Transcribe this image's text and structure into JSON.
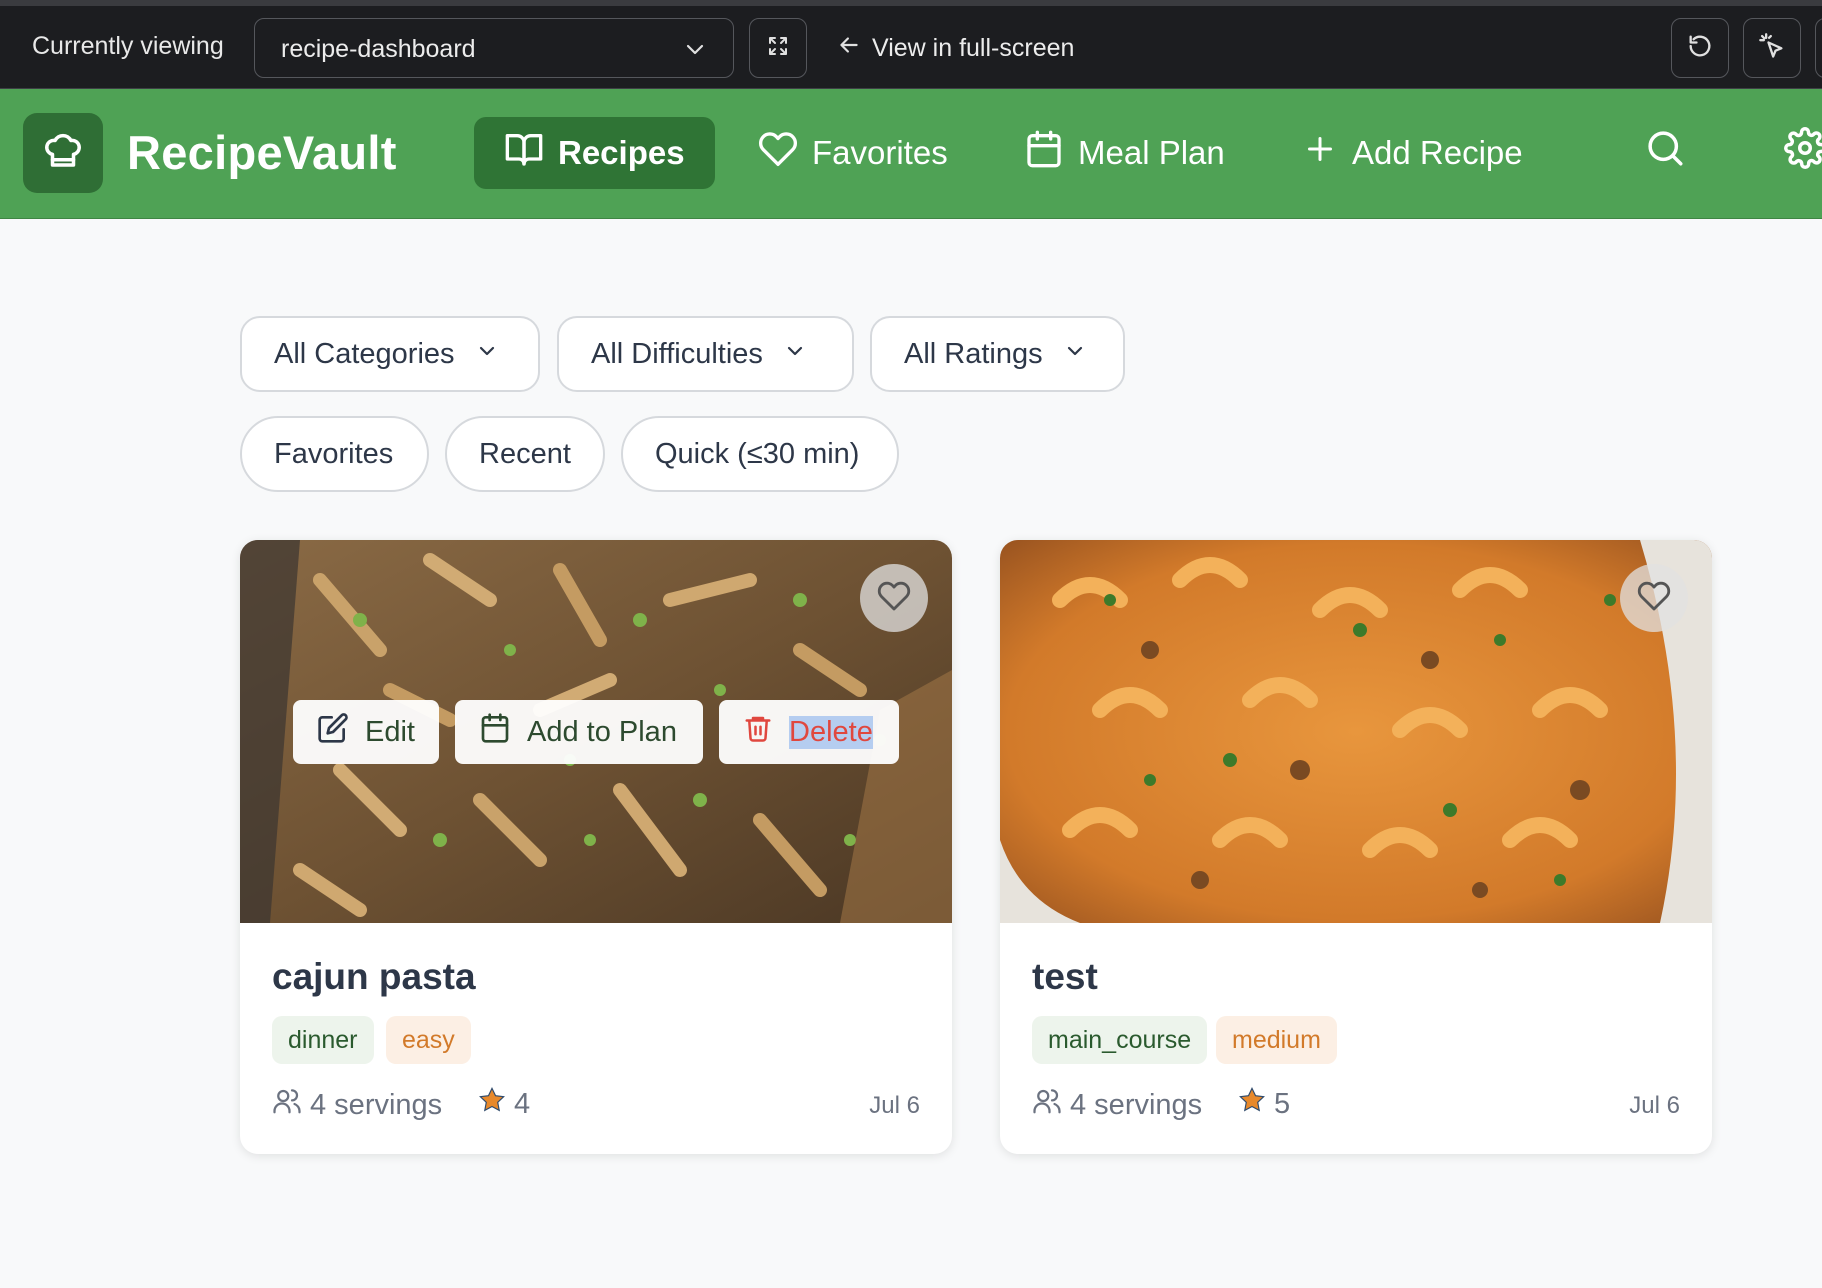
{
  "viewer": {
    "label": "Currently viewing",
    "project": "recipe-dashboard",
    "fullscreen_label": "View in full-screen"
  },
  "nav": {
    "brand": "RecipeVault",
    "items": [
      {
        "label": "Recipes",
        "icon": "book-icon",
        "active": true
      },
      {
        "label": "Favorites",
        "icon": "heart-icon"
      },
      {
        "label": "Meal Plan",
        "icon": "calendar-icon"
      },
      {
        "label": "Add Recipe",
        "icon": "plus-icon"
      }
    ]
  },
  "filters": {
    "selects": [
      "All Categories",
      "All Difficulties",
      "All Ratings"
    ],
    "chips": [
      "Favorites",
      "Recent",
      "Quick (≤30 min)"
    ]
  },
  "cards": [
    {
      "title": "cajun pasta",
      "category": "dinner",
      "difficulty": "easy",
      "servings": "4 servings",
      "rating": "4",
      "date": "Jul 6",
      "actions": {
        "edit": "Edit",
        "plan": "Add to Plan",
        "delete": "Delete"
      }
    },
    {
      "title": "test",
      "category": "main_course",
      "difficulty": "medium",
      "servings": "4 servings",
      "rating": "5",
      "date": "Jul 6"
    }
  ],
  "colors": {
    "brand_green": "#4fa255",
    "brand_green_dark": "#2f7435",
    "danger": "#e0473e",
    "star": "#e8892b"
  }
}
